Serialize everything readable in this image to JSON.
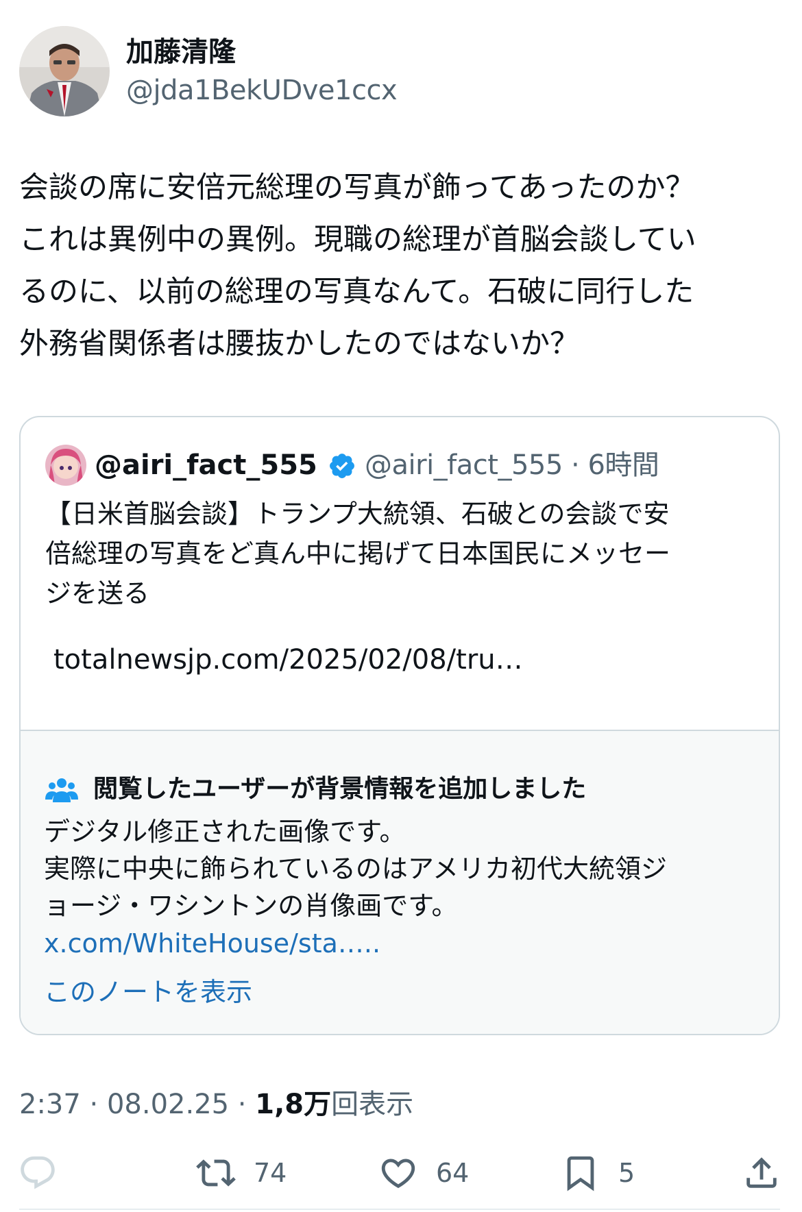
{
  "author": {
    "name": "加藤清隆",
    "handle": "@jda1BekUDve1ccx"
  },
  "tweet": {
    "text": "会談の席に安倍元総理の写真が飾ってあったのか？\nこれは異例中の異例。現職の総理が首脳会談してい\nるのに、以前の総理の写真なんて。石破に同行した\n外務省関係者は腰抜かしたのではないか？"
  },
  "quote": {
    "name": "@airi_fact_555",
    "meta": "@airi_fact_555 · 6時間",
    "text": "【日米首脳会談】トランプ大統領、石破との会談で安\n倍総理の写真をど真ん中に掲げて日本国民にメッセー\nジを送る",
    "link": "totalnewsjp.com/2025/02/08/tru…"
  },
  "community_note": {
    "heading": "閲覧したユーザーが背景情報を追加しました",
    "text": "デジタル修正された画像です。\n実際に中央に飾られているのはアメリカ初代大統領ジ\nョージ・ワシントンの肖像画です。",
    "url": "x.com/WhiteHouse/sta…..",
    "show_note": "このノートを表示"
  },
  "meta": {
    "time_date": "2:37 · 08.02.25 · ",
    "views_count": "1,8万",
    "views_label": "回表示"
  },
  "actions": {
    "retweets": "74",
    "likes": "64",
    "bookmarks": "5"
  },
  "colors": {
    "text": "#0f1419",
    "secondary": "#536471",
    "link": "#1d6fb8",
    "verified": "#1d9bf0",
    "note_bg": "#f7f9f9",
    "border": "#cfd9de"
  }
}
